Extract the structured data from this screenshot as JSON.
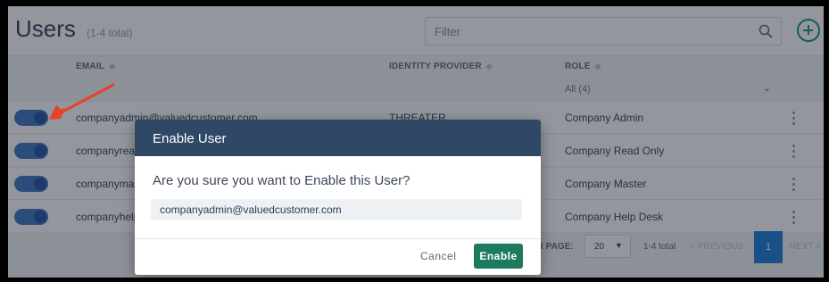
{
  "header": {
    "title": "Users",
    "count": "(1-4 total)",
    "filter_placeholder": "Filter",
    "search_icon": "search-icon",
    "add_icon": "add-circle-icon"
  },
  "columns": {
    "email": "EMAIL",
    "identity_provider": "IDENTITY PROVIDER",
    "role": "ROLE"
  },
  "role_filter": {
    "value": "All (4)"
  },
  "rows": [
    {
      "email": "companyadmin@valuedcustomer.com",
      "identity_provider": "THREATER",
      "role": "Company Admin"
    },
    {
      "email": "companyread",
      "identity_provider": "",
      "role": "Company Read Only"
    },
    {
      "email": "companymast",
      "identity_provider": "",
      "role": "Company Master"
    },
    {
      "email": "companyhelp",
      "identity_provider": "",
      "role": "Company Help Desk"
    }
  ],
  "pagination": {
    "per_page_label": "ER PAGE:",
    "per_page_value": "20",
    "total": "1-4 total",
    "previous": "< PREVIOUS",
    "current_page": "1",
    "next": "NEXT >"
  },
  "modal": {
    "title": "Enable User",
    "question": "Are you sure you want to Enable this User?",
    "email": "companyadmin@valuedcustomer.com",
    "cancel_label": "Cancel",
    "enable_label": "Enable"
  },
  "colors": {
    "modal_header": "#2e4866",
    "enable_button": "#1d7a5f",
    "toggle": "#3a6fbf",
    "annotation_arrow": "#e8402a",
    "page_active": "#1877d6"
  }
}
